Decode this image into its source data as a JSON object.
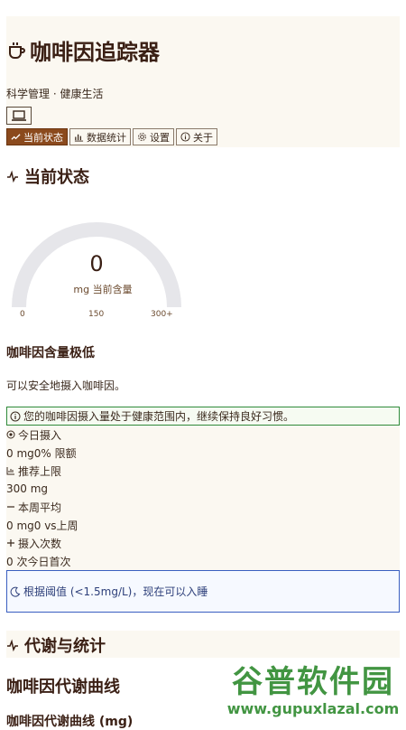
{
  "header": {
    "title": "咖啡因追踪器",
    "subtitle": "科学管理 · 健康生活",
    "tabs": [
      {
        "label": "当前状态",
        "icon": "trend-icon",
        "active": true
      },
      {
        "label": "数据统计",
        "icon": "bar-chart-icon",
        "active": false
      },
      {
        "label": "设置",
        "icon": "gear-icon",
        "active": false
      },
      {
        "label": "关于",
        "icon": "info-icon",
        "active": false
      }
    ]
  },
  "status": {
    "section_title": "当前状态",
    "gauge": {
      "value": "0",
      "unit": "mg 当前含量",
      "ticks": [
        "0",
        "150",
        "300+"
      ],
      "level": 0
    },
    "level_title": "咖啡因含量极低",
    "level_desc": "可以安全地摄入咖啡因。",
    "alert": "您的咖啡因摄入量处于健康范围内，继续保持良好习惯。",
    "stats": [
      {
        "label": "今日摄入",
        "icon": "target-icon"
      },
      {
        "label": "0 mg0% 限额",
        "icon": ""
      },
      {
        "label": "推荐上限",
        "icon": "chart-icon"
      },
      {
        "label": "300 mg",
        "icon": ""
      },
      {
        "label": "本周平均",
        "icon": "minus-icon"
      },
      {
        "label": "0 mg0 vs上周",
        "icon": ""
      },
      {
        "label": "摄入次数",
        "icon": "plus-icon"
      },
      {
        "label": "0 次今日首次",
        "icon": ""
      }
    ],
    "sleep_note": "根据阈值 (<1.5mg/L)，现在可以入睡"
  },
  "metabolism": {
    "section_title": "代谢与统计",
    "chart_title": "咖啡因代谢曲线",
    "chart_subtitle": "咖啡因代谢曲线 (mg)"
  },
  "watermark": {
    "line1": "谷普软件园",
    "line2": "www.gupuxlazal.com"
  },
  "colors": {
    "accent": "#8b4a1d",
    "panel": "#fbf8f1",
    "success_border": "#2f8a3a",
    "info_border": "#3a5fc0"
  }
}
